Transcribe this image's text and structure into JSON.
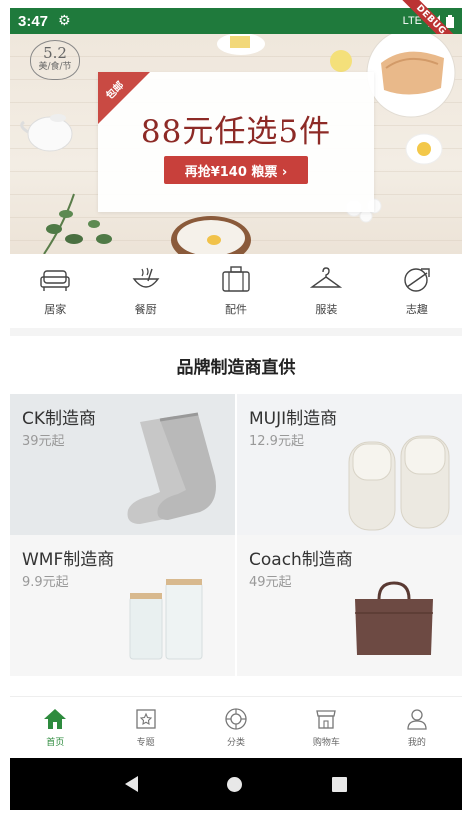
{
  "status_bar": {
    "time": "3:47",
    "network": "LTE",
    "debug_label": "DEBUG",
    "background": "#1f7a3c"
  },
  "banner": {
    "badge_top": "5.2",
    "badge_bottom": "美/食/节",
    "corner_tag": "包邮",
    "headline": "88元任选5件",
    "cta": "再抢¥140 粮票 ›",
    "accent": "#c8403b"
  },
  "categories": [
    {
      "label": "居家",
      "icon": "sofa-icon"
    },
    {
      "label": "餐厨",
      "icon": "cookware-icon"
    },
    {
      "label": "配件",
      "icon": "suitcase-icon"
    },
    {
      "label": "服装",
      "icon": "hanger-icon"
    },
    {
      "label": "志趣",
      "icon": "interest-icon"
    }
  ],
  "section": {
    "title": "品牌制造商直供"
  },
  "products": [
    {
      "name": "CK制造商",
      "price": "39元起",
      "image": "socks-image"
    },
    {
      "name": "MUJI制造商",
      "price": "12.9元起",
      "image": "slippers-image"
    },
    {
      "name": "WMF制造商",
      "price": "9.9元起",
      "image": "canisters-image"
    },
    {
      "name": "Coach制造商",
      "price": "49元起",
      "image": "handbag-image"
    }
  ],
  "bottom_nav": [
    {
      "label": "首页",
      "icon": "home-icon",
      "active": true
    },
    {
      "label": "专题",
      "icon": "topic-icon",
      "active": false
    },
    {
      "label": "分类",
      "icon": "category-icon",
      "active": false
    },
    {
      "label": "购物车",
      "icon": "cart-icon",
      "active": false
    },
    {
      "label": "我的",
      "icon": "profile-icon",
      "active": false
    }
  ],
  "colors": {
    "active_nav": "#2e8b3e",
    "text_primary": "#333333",
    "text_secondary": "#999999"
  }
}
